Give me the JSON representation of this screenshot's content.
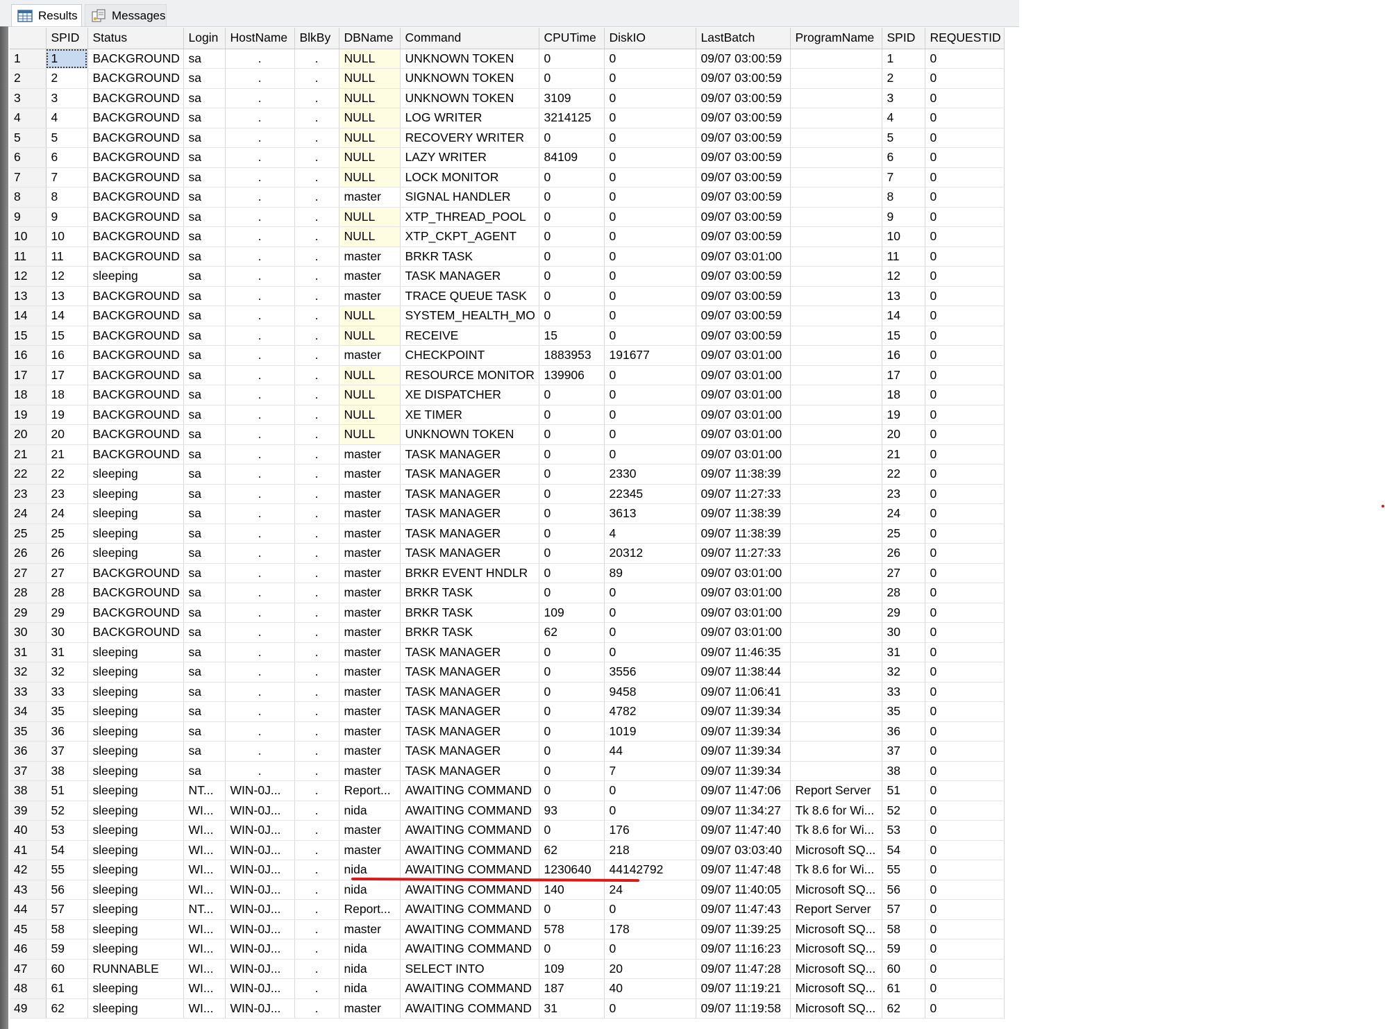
{
  "tabs": [
    {
      "label": "Results",
      "icon": "grid-icon",
      "active": true
    },
    {
      "label": "Messages",
      "icon": "messages-icon",
      "active": false
    }
  ],
  "columns": [
    "",
    "SPID",
    "Status",
    "Login",
    "HostName",
    "BlkBy",
    "DBName",
    "Command",
    "CPUTime",
    "DiskIO",
    "LastBatch",
    "ProgramName",
    "SPID",
    "REQUESTID"
  ],
  "rows": [
    [
      "1",
      "1",
      "BACKGROUND",
      "sa",
      ".",
      ".",
      "NULL",
      "UNKNOWN TOKEN",
      "0",
      "0",
      "09/07 03:00:59",
      "",
      "1",
      "0"
    ],
    [
      "2",
      "2",
      "BACKGROUND",
      "sa",
      ".",
      ".",
      "NULL",
      "UNKNOWN TOKEN",
      "0",
      "0",
      "09/07 03:00:59",
      "",
      "2",
      "0"
    ],
    [
      "3",
      "3",
      "BACKGROUND",
      "sa",
      ".",
      ".",
      "NULL",
      "UNKNOWN TOKEN",
      "3109",
      "0",
      "09/07 03:00:59",
      "",
      "3",
      "0"
    ],
    [
      "4",
      "4",
      "BACKGROUND",
      "sa",
      ".",
      ".",
      "NULL",
      "LOG WRITER",
      "3214125",
      "0",
      "09/07 03:00:59",
      "",
      "4",
      "0"
    ],
    [
      "5",
      "5",
      "BACKGROUND",
      "sa",
      ".",
      ".",
      "NULL",
      "RECOVERY WRITER",
      "0",
      "0",
      "09/07 03:00:59",
      "",
      "5",
      "0"
    ],
    [
      "6",
      "6",
      "BACKGROUND",
      "sa",
      ".",
      ".",
      "NULL",
      "LAZY WRITER",
      "84109",
      "0",
      "09/07 03:00:59",
      "",
      "6",
      "0"
    ],
    [
      "7",
      "7",
      "BACKGROUND",
      "sa",
      ".",
      ".",
      "NULL",
      "LOCK MONITOR",
      "0",
      "0",
      "09/07 03:00:59",
      "",
      "7",
      "0"
    ],
    [
      "8",
      "8",
      "BACKGROUND",
      "sa",
      ".",
      ".",
      "master",
      "SIGNAL HANDLER",
      "0",
      "0",
      "09/07 03:00:59",
      "",
      "8",
      "0"
    ],
    [
      "9",
      "9",
      "BACKGROUND",
      "sa",
      ".",
      ".",
      "NULL",
      "XTP_THREAD_POOL",
      "0",
      "0",
      "09/07 03:00:59",
      "",
      "9",
      "0"
    ],
    [
      "10",
      "10",
      "BACKGROUND",
      "sa",
      ".",
      ".",
      "NULL",
      "XTP_CKPT_AGENT",
      "0",
      "0",
      "09/07 03:00:59",
      "",
      "10",
      "0"
    ],
    [
      "11",
      "11",
      "BACKGROUND",
      "sa",
      ".",
      ".",
      "master",
      "BRKR TASK",
      "0",
      "0",
      "09/07 03:01:00",
      "",
      "11",
      "0"
    ],
    [
      "12",
      "12",
      "sleeping",
      "sa",
      ".",
      ".",
      "master",
      "TASK MANAGER",
      "0",
      "0",
      "09/07 03:00:59",
      "",
      "12",
      "0"
    ],
    [
      "13",
      "13",
      "BACKGROUND",
      "sa",
      ".",
      ".",
      "master",
      "TRACE QUEUE TASK",
      "0",
      "0",
      "09/07 03:00:59",
      "",
      "13",
      "0"
    ],
    [
      "14",
      "14",
      "BACKGROUND",
      "sa",
      ".",
      ".",
      "NULL",
      "SYSTEM_HEALTH_MO",
      "0",
      "0",
      "09/07 03:00:59",
      "",
      "14",
      "0"
    ],
    [
      "15",
      "15",
      "BACKGROUND",
      "sa",
      ".",
      ".",
      "NULL",
      "RECEIVE",
      "15",
      "0",
      "09/07 03:00:59",
      "",
      "15",
      "0"
    ],
    [
      "16",
      "16",
      "BACKGROUND",
      "sa",
      ".",
      ".",
      "master",
      "CHECKPOINT",
      "1883953",
      "191677",
      "09/07 03:01:00",
      "",
      "16",
      "0"
    ],
    [
      "17",
      "17",
      "BACKGROUND",
      "sa",
      ".",
      ".",
      "NULL",
      "RESOURCE MONITOR",
      "139906",
      "0",
      "09/07 03:01:00",
      "",
      "17",
      "0"
    ],
    [
      "18",
      "18",
      "BACKGROUND",
      "sa",
      ".",
      ".",
      "NULL",
      "XE DISPATCHER",
      "0",
      "0",
      "09/07 03:01:00",
      "",
      "18",
      "0"
    ],
    [
      "19",
      "19",
      "BACKGROUND",
      "sa",
      ".",
      ".",
      "NULL",
      "XE TIMER",
      "0",
      "0",
      "09/07 03:01:00",
      "",
      "19",
      "0"
    ],
    [
      "20",
      "20",
      "BACKGROUND",
      "sa",
      ".",
      ".",
      "NULL",
      "UNKNOWN TOKEN",
      "0",
      "0",
      "09/07 03:01:00",
      "",
      "20",
      "0"
    ],
    [
      "21",
      "21",
      "BACKGROUND",
      "sa",
      ".",
      ".",
      "master",
      "TASK MANAGER",
      "0",
      "0",
      "09/07 03:01:00",
      "",
      "21",
      "0"
    ],
    [
      "22",
      "22",
      "sleeping",
      "sa",
      ".",
      ".",
      "master",
      "TASK MANAGER",
      "0",
      "2330",
      "09/07 11:38:39",
      "",
      "22",
      "0"
    ],
    [
      "23",
      "23",
      "sleeping",
      "sa",
      ".",
      ".",
      "master",
      "TASK MANAGER",
      "0",
      "22345",
      "09/07 11:27:33",
      "",
      "23",
      "0"
    ],
    [
      "24",
      "24",
      "sleeping",
      "sa",
      ".",
      ".",
      "master",
      "TASK MANAGER",
      "0",
      "3613",
      "09/07 11:38:39",
      "",
      "24",
      "0"
    ],
    [
      "25",
      "25",
      "sleeping",
      "sa",
      ".",
      ".",
      "master",
      "TASK MANAGER",
      "0",
      "4",
      "09/07 11:38:39",
      "",
      "25",
      "0"
    ],
    [
      "26",
      "26",
      "sleeping",
      "sa",
      ".",
      ".",
      "master",
      "TASK MANAGER",
      "0",
      "20312",
      "09/07 11:27:33",
      "",
      "26",
      "0"
    ],
    [
      "27",
      "27",
      "BACKGROUND",
      "sa",
      ".",
      ".",
      "master",
      "BRKR EVENT HNDLR",
      "0",
      "89",
      "09/07 03:01:00",
      "",
      "27",
      "0"
    ],
    [
      "28",
      "28",
      "BACKGROUND",
      "sa",
      ".",
      ".",
      "master",
      "BRKR TASK",
      "0",
      "0",
      "09/07 03:01:00",
      "",
      "28",
      "0"
    ],
    [
      "29",
      "29",
      "BACKGROUND",
      "sa",
      ".",
      ".",
      "master",
      "BRKR TASK",
      "109",
      "0",
      "09/07 03:01:00",
      "",
      "29",
      "0"
    ],
    [
      "30",
      "30",
      "BACKGROUND",
      "sa",
      ".",
      ".",
      "master",
      "BRKR TASK",
      "62",
      "0",
      "09/07 03:01:00",
      "",
      "30",
      "0"
    ],
    [
      "31",
      "31",
      "sleeping",
      "sa",
      ".",
      ".",
      "master",
      "TASK MANAGER",
      "0",
      "0",
      "09/07 11:46:35",
      "",
      "31",
      "0"
    ],
    [
      "32",
      "32",
      "sleeping",
      "sa",
      ".",
      ".",
      "master",
      "TASK MANAGER",
      "0",
      "3556",
      "09/07 11:38:44",
      "",
      "32",
      "0"
    ],
    [
      "33",
      "33",
      "sleeping",
      "sa",
      ".",
      ".",
      "master",
      "TASK MANAGER",
      "0",
      "9458",
      "09/07 11:06:41",
      "",
      "33",
      "0"
    ],
    [
      "34",
      "35",
      "sleeping",
      "sa",
      ".",
      ".",
      "master",
      "TASK MANAGER",
      "0",
      "4782",
      "09/07 11:39:34",
      "",
      "35",
      "0"
    ],
    [
      "35",
      "36",
      "sleeping",
      "sa",
      ".",
      ".",
      "master",
      "TASK MANAGER",
      "0",
      "1019",
      "09/07 11:39:34",
      "",
      "36",
      "0"
    ],
    [
      "36",
      "37",
      "sleeping",
      "sa",
      ".",
      ".",
      "master",
      "TASK MANAGER",
      "0",
      "44",
      "09/07 11:39:34",
      "",
      "37",
      "0"
    ],
    [
      "37",
      "38",
      "sleeping",
      "sa",
      ".",
      ".",
      "master",
      "TASK MANAGER",
      "0",
      "7",
      "09/07 11:39:34",
      "",
      "38",
      "0"
    ],
    [
      "38",
      "51",
      "sleeping",
      "NT...",
      "WIN-0J...",
      ".",
      "Report...",
      "AWAITING COMMAND",
      "0",
      "0",
      "09/07 11:47:06",
      "Report Server",
      "51",
      "0"
    ],
    [
      "39",
      "52",
      "sleeping",
      "WI...",
      "WIN-0J...",
      ".",
      "nida",
      "AWAITING COMMAND",
      "93",
      "0",
      "09/07 11:34:27",
      "Tk 8.6 for Wi...",
      "52",
      "0"
    ],
    [
      "40",
      "53",
      "sleeping",
      "WI...",
      "WIN-0J...",
      ".",
      "master",
      "AWAITING COMMAND",
      "0",
      "176",
      "09/07 11:47:40",
      "Tk 8.6 for Wi...",
      "53",
      "0"
    ],
    [
      "41",
      "54",
      "sleeping",
      "WI...",
      "WIN-0J...",
      ".",
      "master",
      "AWAITING COMMAND",
      "62",
      "218",
      "09/07 03:03:40",
      "Microsoft SQ...",
      "54",
      "0"
    ],
    [
      "42",
      "55",
      "sleeping",
      "WI...",
      "WIN-0J...",
      ".",
      "nida",
      "AWAITING COMMAND",
      "1230640",
      "44142792",
      "09/07 11:47:48",
      "Tk 8.6 for Wi...",
      "55",
      "0"
    ],
    [
      "43",
      "56",
      "sleeping",
      "WI...",
      "WIN-0J...",
      ".",
      "nida",
      "AWAITING COMMAND",
      "140",
      "24",
      "09/07 11:40:05",
      "Microsoft SQ...",
      "56",
      "0"
    ],
    [
      "44",
      "57",
      "sleeping",
      "NT...",
      "WIN-0J...",
      ".",
      "Report...",
      "AWAITING COMMAND",
      "0",
      "0",
      "09/07 11:47:43",
      "Report Server",
      "57",
      "0"
    ],
    [
      "45",
      "58",
      "sleeping",
      "WI...",
      "WIN-0J...",
      ".",
      "master",
      "AWAITING COMMAND",
      "578",
      "178",
      "09/07 11:39:25",
      "Microsoft SQ...",
      "58",
      "0"
    ],
    [
      "46",
      "59",
      "sleeping",
      "WI...",
      "WIN-0J...",
      ".",
      "nida",
      "AWAITING COMMAND",
      "0",
      "0",
      "09/07 11:16:23",
      "Microsoft SQ...",
      "59",
      "0"
    ],
    [
      "47",
      "60",
      "RUNNABLE",
      "WI...",
      "WIN-0J...",
      ".",
      "nida",
      "SELECT INTO",
      "109",
      "20",
      "09/07 11:47:28",
      "Microsoft SQ...",
      "60",
      "0"
    ],
    [
      "48",
      "61",
      "sleeping",
      "WI...",
      "WIN-0J...",
      ".",
      "nida",
      "AWAITING COMMAND",
      "187",
      "40",
      "09/07 11:19:21",
      "Microsoft SQ...",
      "61",
      "0"
    ],
    [
      "49",
      "62",
      "sleeping",
      "WI...",
      "WIN-0J...",
      ".",
      "master",
      "AWAITING COMMAND",
      "31",
      "0",
      "09/07 11:19:58",
      "Microsoft SQ...",
      "62",
      "0"
    ]
  ],
  "colors": {
    "null_cell_bg": "#fffde1",
    "annotation_red": "#d81a1a",
    "selected_cell_bg": "#c7daf0"
  }
}
